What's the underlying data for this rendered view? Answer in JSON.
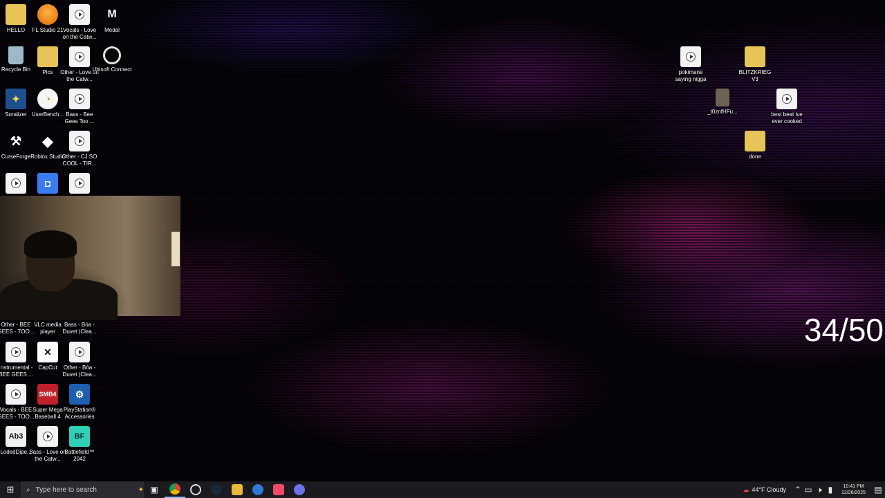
{
  "desktop": {
    "icons": [
      {
        "label": "HELLO",
        "icon": "folder-icon"
      },
      {
        "label": "FL Studio 21",
        "icon": "fl-studio-icon"
      },
      {
        "label": "Vocals - Love on the Catw...",
        "icon": "media-file-icon"
      },
      {
        "label": "Medal",
        "icon": "medal-icon"
      },
      {
        "label": "Recycle Bin",
        "icon": "recycle-bin-icon"
      },
      {
        "label": "Pics",
        "icon": "folder-icon"
      },
      {
        "label": "Other - Love on the Catw...",
        "icon": "media-file-icon"
      },
      {
        "label": "Ubisoft Connect",
        "icon": "ubisoft-icon"
      },
      {
        "label": "Soralizer",
        "icon": "soralizer-icon"
      },
      {
        "label": "UserBench...",
        "icon": "userbenchmark-icon"
      },
      {
        "label": "Bass - Bee Gees Too ...",
        "icon": "media-file-icon"
      },
      {
        "label": "CurseForge",
        "icon": "curseforge-icon"
      },
      {
        "label": "Roblox Studio",
        "icon": "roblox-studio-icon"
      },
      {
        "label": "Other - CJ SO COOL - TIR...",
        "icon": "media-file-icon"
      },
      {
        "label": "Other - BEE GEES - TOO...",
        "icon": "media-file-icon"
      },
      {
        "label": "VLC media player",
        "icon": "vlc-icon"
      },
      {
        "label": "Bass - Bóa - Duvet (Clea...",
        "icon": "media-file-icon"
      },
      {
        "label": "Instrumental - BEE GEES ...",
        "icon": "media-file-icon"
      },
      {
        "label": "CapCut",
        "icon": "capcut-icon"
      },
      {
        "label": "Other - Bóa - Duvet (Clea...",
        "icon": "media-file-icon"
      },
      {
        "label": "Vocals - BEE GEES - TOO...",
        "icon": "media-file-icon"
      },
      {
        "label": "Super Mega Baseball 4",
        "icon": "smb4-icon"
      },
      {
        "label": "PlayStation® Accessories",
        "icon": "playstation-icon"
      },
      {
        "label": "LodedDipe...",
        "icon": "abc-icon"
      },
      {
        "label": "Bass - Love on the Catw...",
        "icon": "media-file-icon"
      },
      {
        "label": "Battlefield™ 2042",
        "icon": "battlefield-icon"
      },
      {
        "label": "pokimane saying nigga",
        "icon": "media-file-icon"
      },
      {
        "label": "BLITZKRIEG V3",
        "icon": "folder-icon"
      },
      {
        "label": "_t0znfHFu...",
        "icon": "image-file-icon"
      },
      {
        "label": "best beat ive ever cooked",
        "icon": "media-file-icon"
      },
      {
        "label": "done",
        "icon": "folder-icon"
      }
    ],
    "overlay_counter": "34/50"
  },
  "taskbar": {
    "search_placeholder": "Type here to search",
    "weather": "44°F  Cloudy",
    "time": "10:41 PM",
    "date": "12/26/2025"
  },
  "colors": {
    "taskbar": "#1b1b1f",
    "accent": "#8fb6ff"
  }
}
